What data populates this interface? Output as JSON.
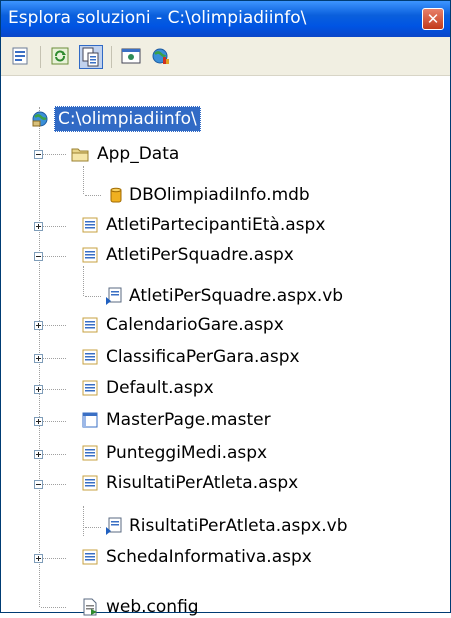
{
  "window": {
    "title": "Esplora soluzioni - C:\\olimpiadiinfo\\",
    "close_glyph": "✕"
  },
  "toolbar": {
    "buttons": [
      {
        "icon": "properties-icon"
      },
      {
        "icon": "refresh-icon"
      },
      {
        "icon": "show-all-files-icon"
      },
      {
        "icon": "view-designer-icon"
      },
      {
        "icon": "copy-website-icon"
      }
    ]
  },
  "tree": {
    "root": {
      "label": "C:\\olimpiadiinfo\\",
      "icon": "website-icon"
    },
    "nodes": [
      {
        "label": "App_Data",
        "icon": "folder-icon",
        "expander": "minus"
      },
      {
        "label": "DBOlimpiadiInfo.mdb",
        "icon": "database-icon",
        "expander": ""
      },
      {
        "label": "AtletiPartecipantiEtà.aspx",
        "icon": "aspx-page-icon",
        "expander": "plus"
      },
      {
        "label": "AtletiPerSquadre.aspx",
        "icon": "aspx-page-icon",
        "expander": "minus"
      },
      {
        "label": "AtletiPerSquadre.aspx.vb",
        "icon": "vb-code-icon",
        "expander": ""
      },
      {
        "label": "CalendarioGare.aspx",
        "icon": "aspx-page-icon",
        "expander": "plus"
      },
      {
        "label": "ClassificaPerGara.aspx",
        "icon": "aspx-page-icon",
        "expander": "plus"
      },
      {
        "label": "Default.aspx",
        "icon": "aspx-page-icon",
        "expander": "plus"
      },
      {
        "label": "MasterPage.master",
        "icon": "master-page-icon",
        "expander": "plus"
      },
      {
        "label": "PunteggiMedi.aspx",
        "icon": "aspx-page-icon",
        "expander": "plus"
      },
      {
        "label": "RisultatiPerAtleta.aspx",
        "icon": "aspx-page-icon",
        "expander": "minus"
      },
      {
        "label": "RisultatiPerAtleta.aspx.vb",
        "icon": "vb-code-icon",
        "expander": ""
      },
      {
        "label": "SchedaInformativa.aspx",
        "icon": "aspx-page-icon",
        "expander": "plus"
      },
      {
        "label": "web.config",
        "icon": "config-file-icon",
        "expander": ""
      }
    ]
  },
  "colors": {
    "titlebar": "#0054e3",
    "selection": "#316ac5",
    "toolbar_bg": "#f1efe2"
  }
}
